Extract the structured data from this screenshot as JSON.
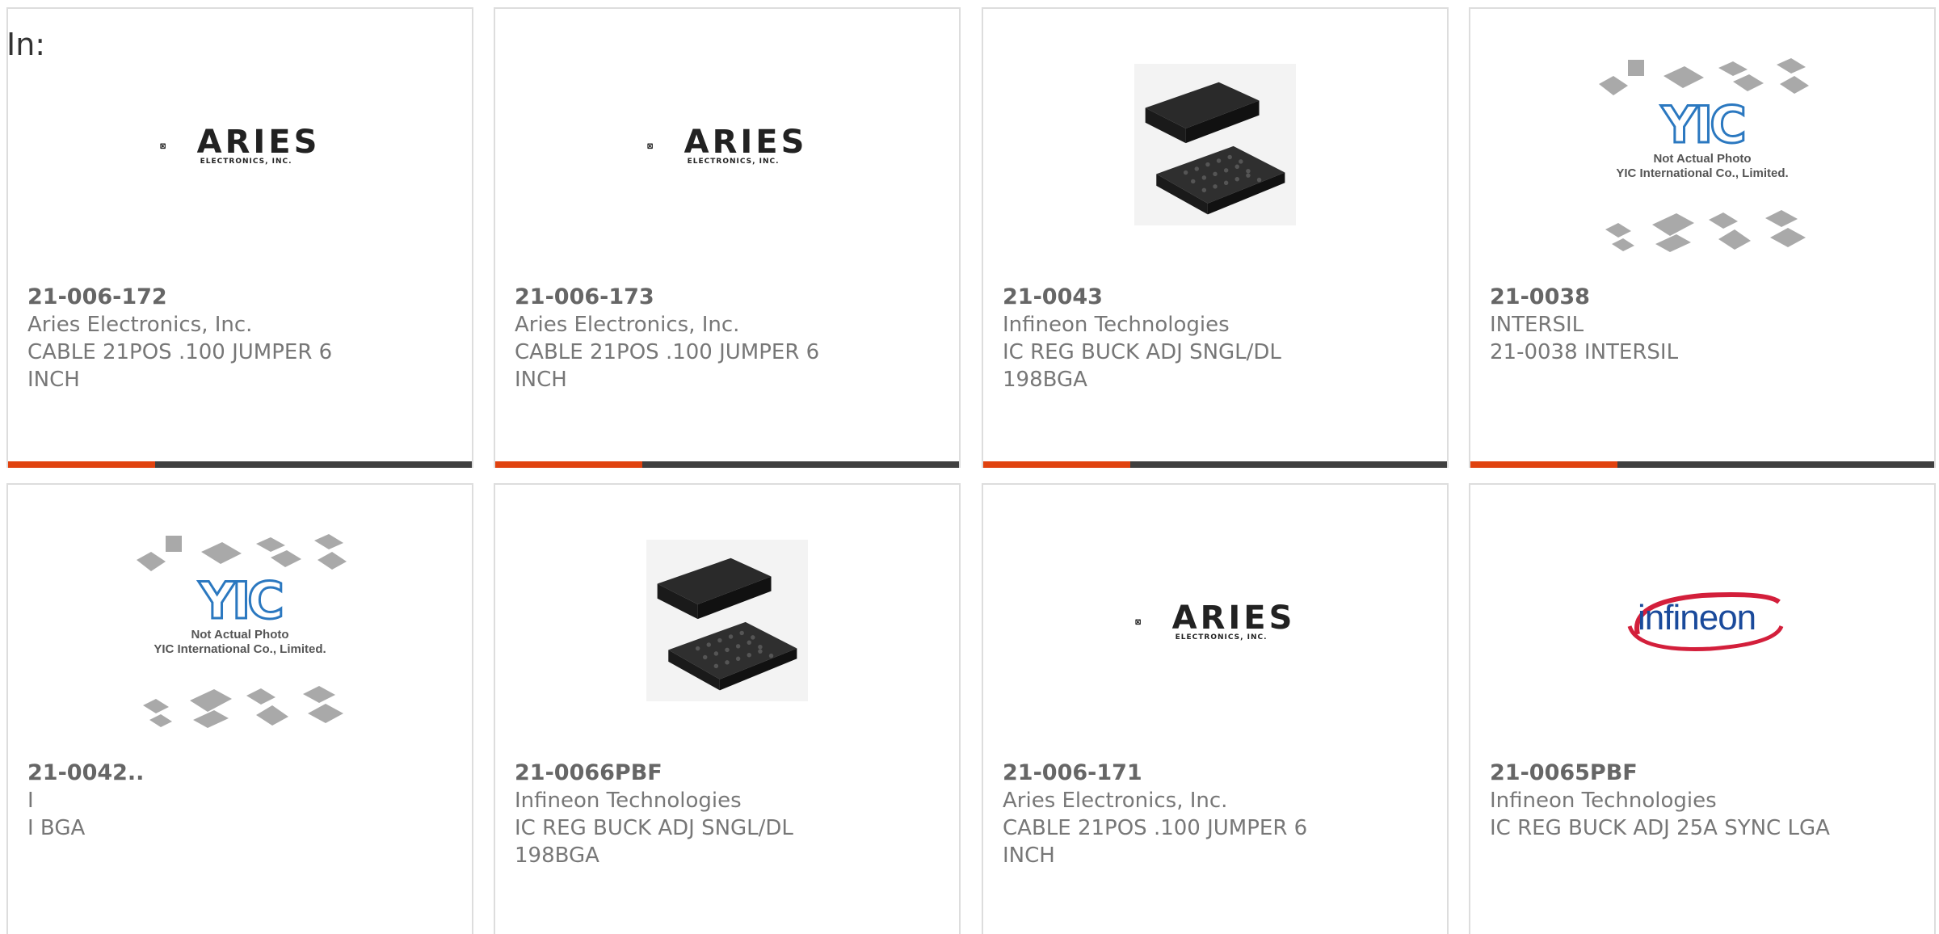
{
  "header": {
    "in_label": "In:"
  },
  "logos": {
    "aries": {
      "text": "ARIES",
      "sub": "ELECTRONICS, INC."
    },
    "yic": {
      "mark": "YIC",
      "line1": "Not Actual Photo",
      "line2": "YIC International Co., Limited."
    },
    "infineon": {
      "text": "infineon"
    }
  },
  "products": [
    {
      "part": "21-006-172",
      "manufacturer": "Aries Electronics, Inc.",
      "desc1": "CABLE 21POS .100 JUMPER 6",
      "desc2": "INCH",
      "image": "aries-logo"
    },
    {
      "part": "21-006-173",
      "manufacturer": "Aries Electronics, Inc.",
      "desc1": "CABLE 21POS .100 JUMPER 6",
      "desc2": "INCH",
      "image": "aries-logo"
    },
    {
      "part": "21-0043",
      "manufacturer": "Infineon Technologies",
      "desc1": "IC REG BUCK ADJ SNGL/DL",
      "desc2": "198BGA",
      "image": "bga-chip"
    },
    {
      "part": "21-0038",
      "manufacturer": "INTERSIL",
      "desc1": "21-0038 INTERSIL",
      "desc2": "",
      "image": "yic-placeholder"
    },
    {
      "part": "21-0042..",
      "manufacturer": "I",
      "desc1": "I BGA",
      "desc2": "",
      "image": "yic-placeholder"
    },
    {
      "part": "21-0066PBF",
      "manufacturer": "Infineon Technologies",
      "desc1": "IC REG BUCK ADJ SNGL/DL",
      "desc2": "198BGA",
      "image": "bga-chip"
    },
    {
      "part": "21-006-171",
      "manufacturer": "Aries Electronics, Inc.",
      "desc1": "CABLE 21POS .100 JUMPER 6",
      "desc2": "INCH",
      "image": "aries-logo"
    },
    {
      "part": "21-0065PBF",
      "manufacturer": "Infineon Technologies",
      "desc1": "IC REG BUCK ADJ 25A SYNC LGA",
      "desc2": "",
      "image": "infineon-logo"
    }
  ],
  "colors": {
    "accent": "#e0420f",
    "bar": "#3f3f3f",
    "card_border": "#dddddd",
    "text": "#666666"
  }
}
